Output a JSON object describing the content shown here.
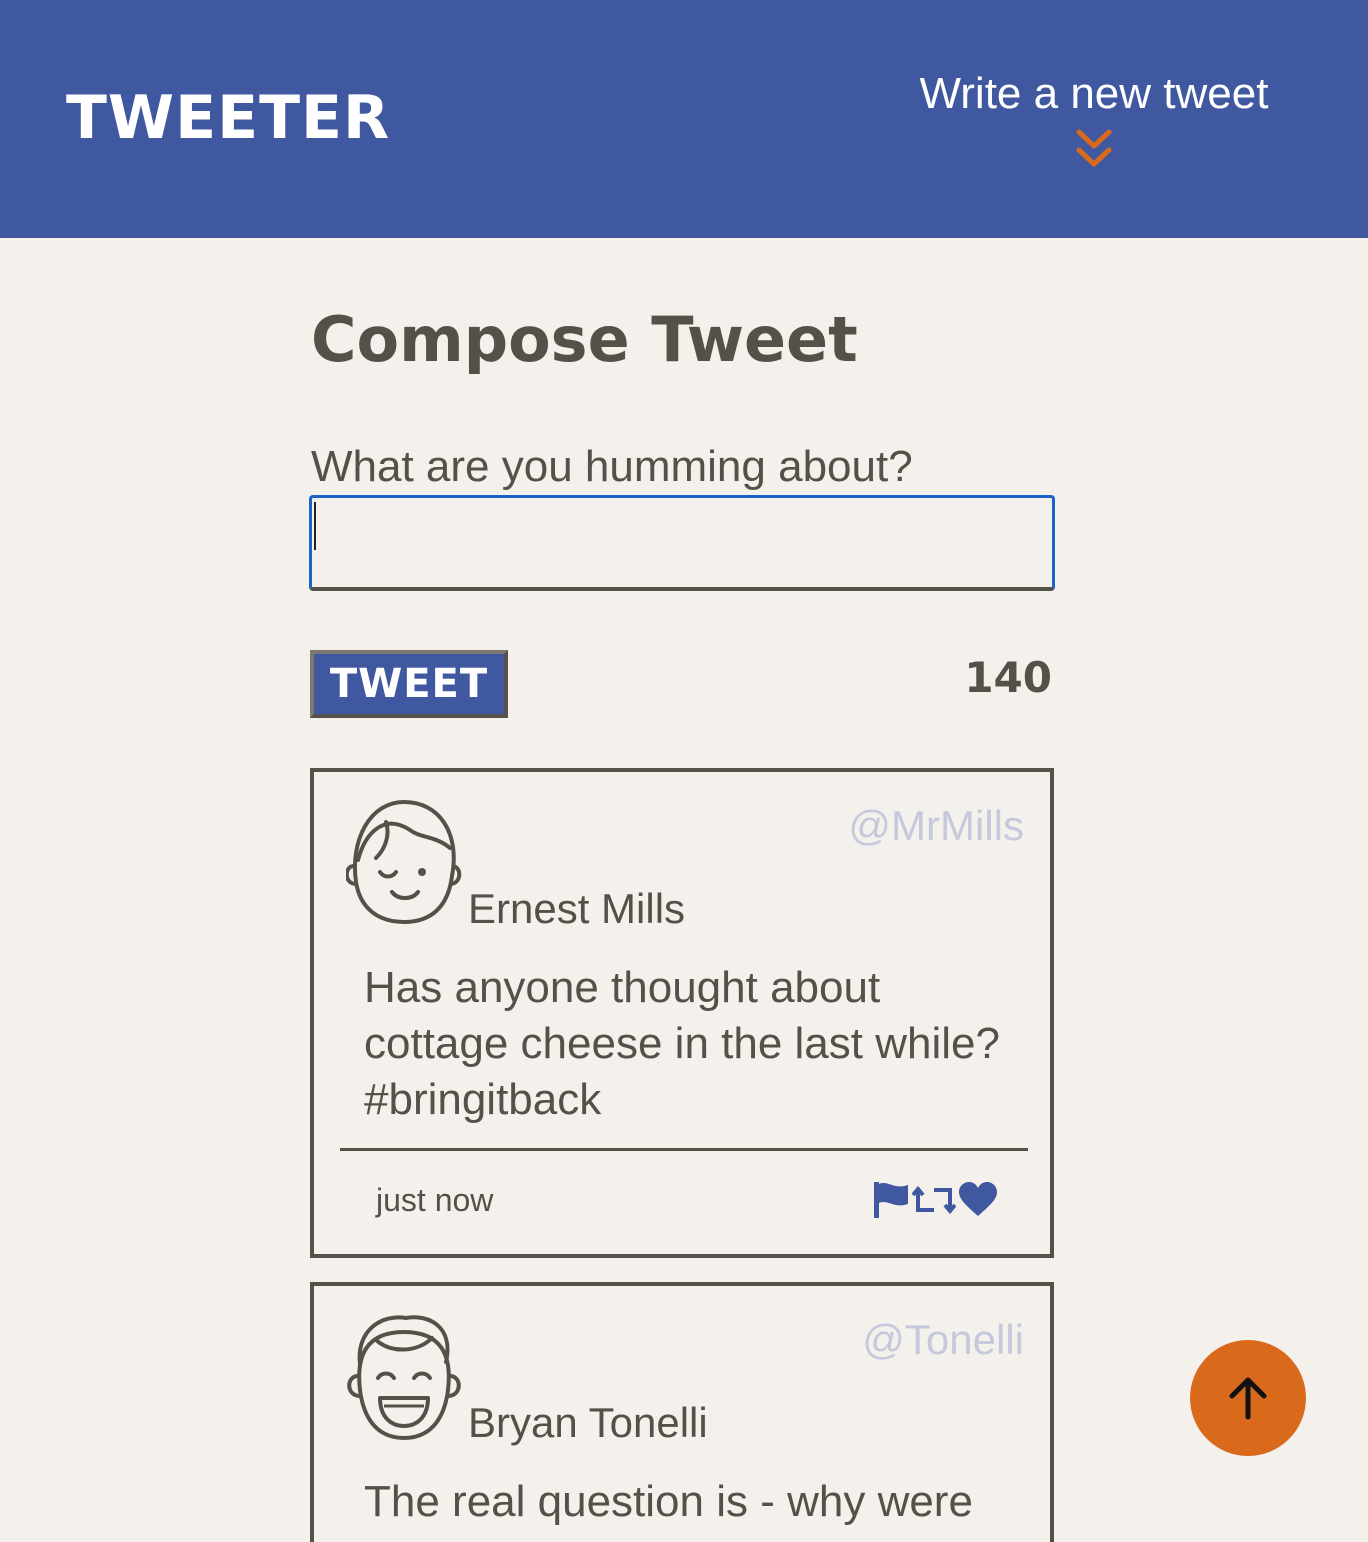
{
  "nav": {
    "brand": "TWEETER",
    "compose_toggle_label": "Write a new tweet",
    "compose_toggle_icon": "double-chevron-down-icon"
  },
  "compose": {
    "title": "Compose Tweet",
    "prompt_label": "What are you humming about?",
    "input_value": "",
    "button_label": "TWEET",
    "char_counter": "140"
  },
  "tweets": [
    {
      "handle": "@MrMills",
      "author": "Ernest Mills",
      "avatar_icon": "winking-face-avatar-icon",
      "body": "Has anyone thought about cottage cheese in the last while? #bringitback",
      "timestamp": "just now",
      "actions": [
        "flag-icon",
        "retweet-icon",
        "heart-icon"
      ]
    },
    {
      "handle": "@Tonelli",
      "author": "Bryan Tonelli",
      "avatar_icon": "laughing-face-avatar-icon",
      "body": "The real question is - why were"
    }
  ],
  "scroll_to_top_icon": "arrow-up-icon",
  "colors": {
    "nav_background": "#4058a0",
    "page_background": "#f4f1ec",
    "text": "#545149",
    "accent": "#d96a1c",
    "handle": "#c6c9dc",
    "input_focus": "#1a63c9"
  }
}
